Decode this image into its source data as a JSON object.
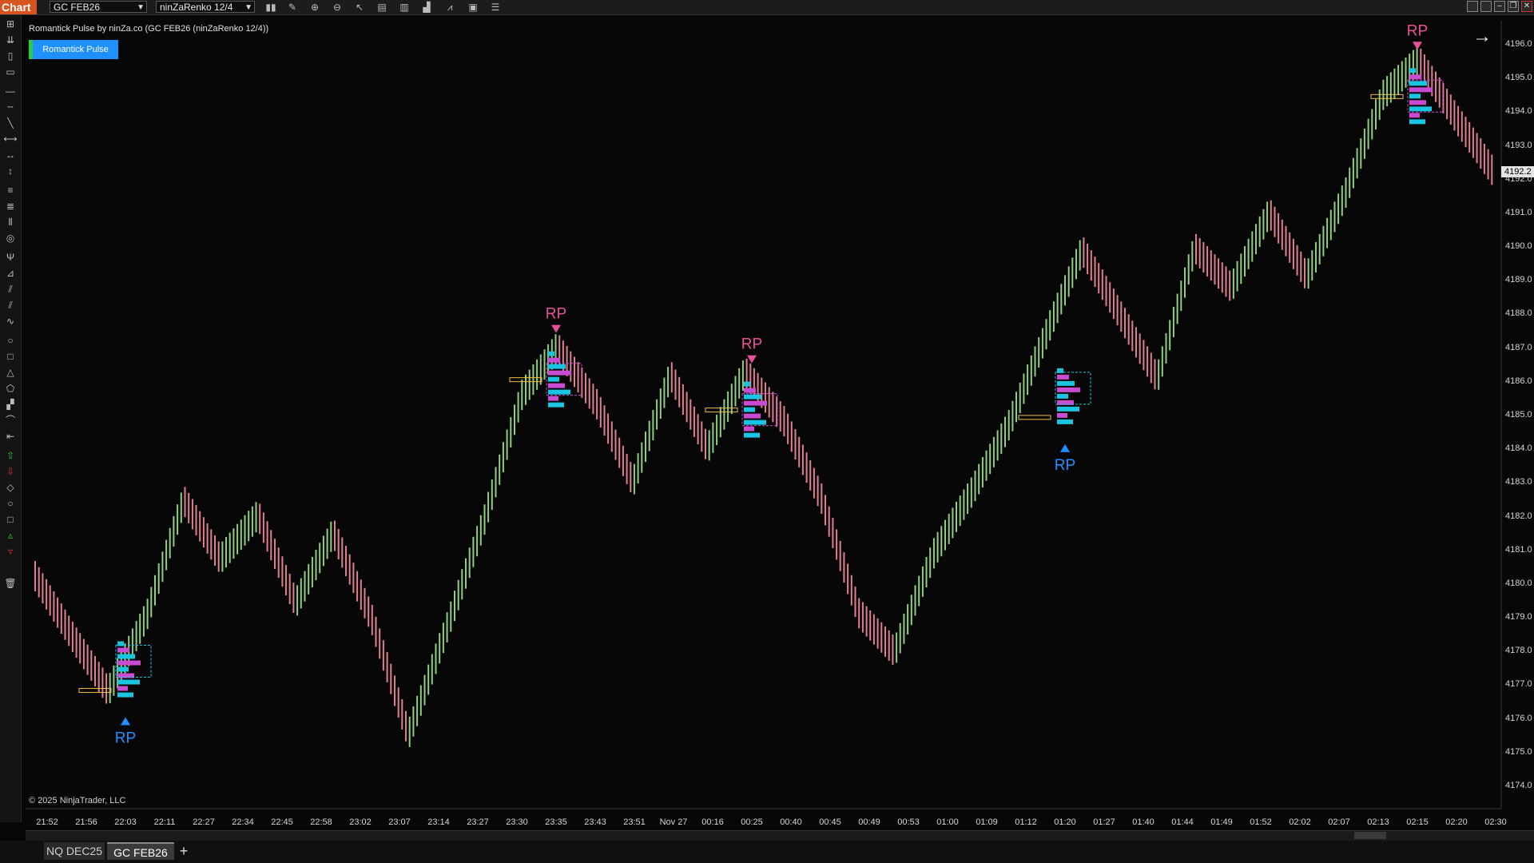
{
  "app": {
    "title": "Chart"
  },
  "toolbar": {
    "instrument": "GC FEB26",
    "bar_type": "ninZaRenko 12/4",
    "icons": [
      "bar-type-icon",
      "pencil-icon",
      "zoom-in-icon",
      "zoom-out-icon",
      "pointer-icon",
      "properties-icon",
      "templates-icon",
      "indicators-icon",
      "strategies-icon",
      "chart-trader-icon",
      "data-box-icon"
    ]
  },
  "chart": {
    "indicator_label": "Romantick Pulse by ninZa.co (GC FEB26 (ninZaRenko 12/4))",
    "indicator_button": "Romantick Pulse",
    "copyright": "© 2025 NinjaTrader, LLC",
    "last_price": "4192.2",
    "signal_text": "RP",
    "colors": {
      "up_bar": "#8fcf7f",
      "down_bar": "#e07f8f",
      "buy_signal": "#1e90ff",
      "sell_signal": "#e8509a",
      "cyan": "#19c5e0",
      "magenta": "#c94bd1",
      "gold": "#f0c040"
    }
  },
  "price_axis": [
    "4196.0",
    "4195.0",
    "4194.0",
    "4193.0",
    "4192.0",
    "4191.0",
    "4190.0",
    "4189.0",
    "4188.0",
    "4187.0",
    "4186.0",
    "4185.0",
    "4184.0",
    "4183.0",
    "4182.0",
    "4181.0",
    "4180.0",
    "4179.0",
    "4178.0",
    "4177.0",
    "4176.0",
    "4175.0",
    "4174.0"
  ],
  "time_axis": [
    "21:52",
    "21:56",
    "22:03",
    "22:11",
    "22:27",
    "22:34",
    "22:45",
    "22:58",
    "23:02",
    "23:07",
    "23:14",
    "23:27",
    "23:30",
    "23:35",
    "23:43",
    "23:51",
    "Nov 27",
    "00:16",
    "00:25",
    "00:40",
    "00:45",
    "00:49",
    "00:53",
    "01:00",
    "01:09",
    "01:12",
    "01:20",
    "01:27",
    "01:40",
    "01:44",
    "01:49",
    "01:52",
    "02:02",
    "02:07",
    "02:13",
    "02:15",
    "02:20",
    "02:30"
  ],
  "tabs": [
    "NQ DEC25",
    "GC FEB26"
  ],
  "tab_add": "+",
  "chart_data": {
    "type": "line",
    "title": "",
    "series": [
      {
        "values": [
          4180.3,
          4178.5,
          4176.8,
          4179.0,
          4182.5,
          4180.7,
          4182.0,
          4179.4,
          4181.5,
          4179.0,
          4175.5,
          4178.6,
          4181.8,
          4185.5,
          4187.0,
          4185.4,
          4183.0,
          4186.2,
          4184.0,
          4186.3,
          4184.9,
          4182.6,
          4179.2,
          4178.0,
          4180.8,
          4182.6,
          4184.6,
          4187.3,
          4189.9,
          4188.0,
          4186.1,
          4190.0,
          4188.8,
          4191.0,
          4189.1,
          4191.5,
          4194.4,
          4195.5,
          4193.8,
          4192.2
        ]
      }
    ],
    "ylim": [
      4174.0,
      4196.0
    ],
    "signals": [
      {
        "type": "buy",
        "label": "RP",
        "time": "22:03",
        "price": 4176.5
      },
      {
        "type": "sell",
        "label": "RP",
        "time": "23:35",
        "price": 4187.0
      },
      {
        "type": "sell",
        "label": "RP",
        "time": "00:25",
        "price": 4186.1
      },
      {
        "type": "buy",
        "label": "RP",
        "time": "01:20",
        "price": 4184.6
      },
      {
        "type": "sell",
        "label": "RP",
        "time": "02:15",
        "price": 4195.4
      }
    ]
  }
}
